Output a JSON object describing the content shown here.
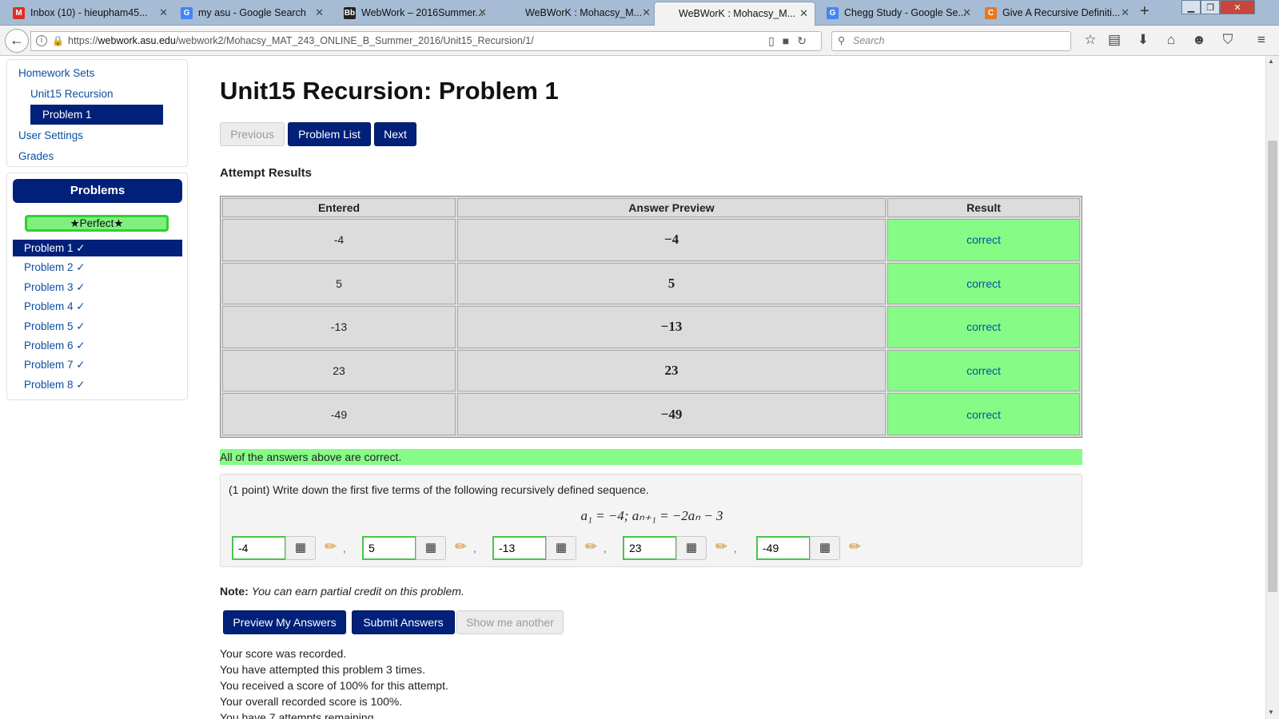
{
  "browser": {
    "tabs": [
      {
        "title": "Inbox (10) - hieupham45...",
        "icon": "gmail-icon",
        "icon_glyph": "M",
        "icon_color": "#d93025"
      },
      {
        "title": "my asu - Google Search",
        "icon": "google-icon",
        "icon_glyph": "G",
        "icon_color": "#4285f4"
      },
      {
        "title": "WebWork – 2016Summer...",
        "icon": "blackboard-icon",
        "icon_glyph": "Bb",
        "icon_color": "#222222"
      },
      {
        "title": "WeBWorK : Mohacsy_M...",
        "icon": "",
        "icon_glyph": "",
        "icon_color": ""
      },
      {
        "title": "WeBWorK : Mohacsy_M...",
        "icon": "",
        "icon_glyph": "",
        "icon_color": ""
      },
      {
        "title": "Chegg Study - Google Se...",
        "icon": "google-icon",
        "icon_glyph": "G",
        "icon_color": "#4285f4"
      },
      {
        "title": "Give A Recursive Definiti...",
        "icon": "chegg-icon",
        "icon_glyph": "C",
        "icon_color": "#e87722"
      }
    ],
    "active_tab_index": 4,
    "url_prefix": "https://",
    "url_host": "webwork.asu.edu",
    "url_path": "/webwork2/Mohacsy_MAT_243_ONLINE_B_Summer_2016/Unit15_Recursion/1/",
    "search_placeholder": "Search"
  },
  "sidebar": {
    "nav": {
      "homework_sets": "Homework Sets",
      "set_name": "Unit15 Recursion",
      "current_problem": "Problem 1",
      "user_settings": "User Settings",
      "grades": "Grades"
    },
    "problems_header": "Problems",
    "perfect_badge": "★Perfect★",
    "problems": [
      {
        "label": "Problem 1 ✓",
        "active": true
      },
      {
        "label": "Problem 2 ✓",
        "active": false
      },
      {
        "label": "Problem 3 ✓",
        "active": false
      },
      {
        "label": "Problem 4 ✓",
        "active": false
      },
      {
        "label": "Problem 5 ✓",
        "active": false
      },
      {
        "label": "Problem 6 ✓",
        "active": false
      },
      {
        "label": "Problem 7 ✓",
        "active": false
      },
      {
        "label": "Problem 8 ✓",
        "active": false
      }
    ]
  },
  "main": {
    "title": "Unit15 Recursion: Problem 1",
    "nav_buttons": {
      "previous": "Previous",
      "problem_list": "Problem List",
      "next": "Next"
    },
    "attempt_results_title": "Attempt Results",
    "results_table": {
      "headers": [
        "Entered",
        "Answer Preview",
        "Result"
      ],
      "rows": [
        {
          "entered": "-4",
          "preview": "−4",
          "result": "correct"
        },
        {
          "entered": "5",
          "preview": "5",
          "result": "correct"
        },
        {
          "entered": "-13",
          "preview": "−13",
          "result": "correct"
        },
        {
          "entered": "23",
          "preview": "23",
          "result": "correct"
        },
        {
          "entered": "-49",
          "preview": "−49",
          "result": "correct"
        }
      ]
    },
    "all_correct_message": "All of the answers above are correct.",
    "problem": {
      "text": "(1 point) Write down the first five terms of the following recursively defined sequence.",
      "formula": "a₁ = −4;  aₙ₊₁ = −2aₙ − 3",
      "answers": [
        "-4",
        "5",
        "-13",
        "23",
        "-49"
      ],
      "separator": ","
    },
    "note_label": "Note:",
    "note_body": "You can earn partial credit on this problem.",
    "action_buttons": {
      "preview": "Preview My Answers",
      "submit": "Submit Answers",
      "show_another": "Show me another"
    },
    "score_messages": [
      "Your score was recorded.",
      "You have attempted this problem 3 times.",
      "You received a score of 100% for this attempt.",
      "Your overall recorded score is 100%.",
      "You have 7 attempts remaining."
    ]
  },
  "colors": {
    "primary": "#00207a",
    "correct": "#86fb86",
    "link": "#0b4fa1"
  }
}
